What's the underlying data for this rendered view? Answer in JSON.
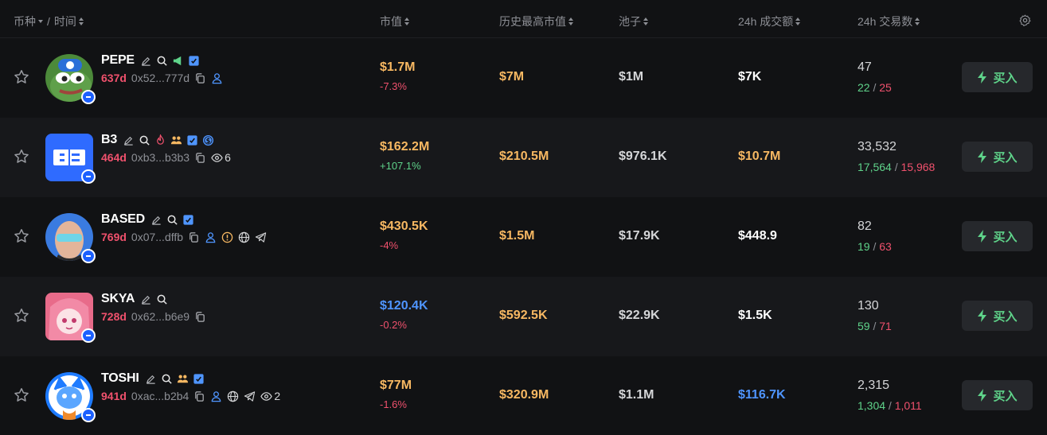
{
  "header": {
    "coin_label": "币种",
    "sep": "/",
    "time_label": "时间",
    "mcap_label": "市值",
    "ath_label": "历史最高市值",
    "pool_label": "池子",
    "vol_label": "24h 成交额",
    "txs_label": "24h 交易数"
  },
  "colors": {
    "bg": "#111214",
    "alt_row": "#17181b",
    "yellow": "#f7b862",
    "blue": "#4f95ff",
    "red": "#f0516d",
    "green": "#5fd38a"
  },
  "buy_label": "买入",
  "rows": [
    {
      "ticker": "PEPE",
      "age": "637d",
      "address": "0x52...777d",
      "badges": [
        "edit-icon",
        "search-icon",
        "megaphone-icon",
        "verified-icon"
      ],
      "line2_icons": [
        "copy-icon",
        "user-icon"
      ],
      "watch_count": "",
      "mcap": "$1.7M",
      "mcap_color": "yellow",
      "change": "-7.3%",
      "change_color": "red",
      "ath": "$7M",
      "pool": "$1M",
      "vol": "$7K",
      "vol_color": "white",
      "txs": "47",
      "buys": "22",
      "sells": "25"
    },
    {
      "ticker": "B3",
      "age": "464d",
      "address": "0xb3...b3b3",
      "badges": [
        "edit-icon",
        "search-icon",
        "fire-icon",
        "group-icon",
        "verified-icon",
        "dollar-icon"
      ],
      "line2_icons": [
        "copy-icon",
        "eye-icon"
      ],
      "watch_count": "6",
      "mcap": "$162.2M",
      "mcap_color": "yellow",
      "change": "+107.1%",
      "change_color": "green",
      "ath": "$210.5M",
      "pool": "$976.1K",
      "vol": "$10.7M",
      "vol_color": "yellow",
      "txs": "33,532",
      "buys": "17,564",
      "sells": "15,968"
    },
    {
      "ticker": "BASED",
      "age": "769d",
      "address": "0x07...dffb",
      "badges": [
        "edit-icon",
        "search-icon",
        "verified-icon"
      ],
      "line2_icons": [
        "copy-icon",
        "user-icon",
        "warning-icon",
        "globe-icon",
        "telegram-icon"
      ],
      "watch_count": "",
      "mcap": "$430.5K",
      "mcap_color": "yellow",
      "change": "-4%",
      "change_color": "red",
      "ath": "$1.5M",
      "pool": "$17.9K",
      "vol": "$448.9",
      "vol_color": "white",
      "txs": "82",
      "buys": "19",
      "sells": "63"
    },
    {
      "ticker": "SKYA",
      "age": "728d",
      "address": "0x62...b6e9",
      "badges": [
        "edit-icon",
        "search-icon"
      ],
      "line2_icons": [
        "copy-icon"
      ],
      "watch_count": "",
      "mcap": "$120.4K",
      "mcap_color": "blue",
      "change": "-0.2%",
      "change_color": "red",
      "ath": "$592.5K",
      "pool": "$22.9K",
      "vol": "$1.5K",
      "vol_color": "white",
      "txs": "130",
      "buys": "59",
      "sells": "71"
    },
    {
      "ticker": "TOSHI",
      "age": "941d",
      "address": "0xac...b2b4",
      "badges": [
        "edit-icon",
        "search-icon",
        "group-icon",
        "verified-icon"
      ],
      "line2_icons": [
        "copy-icon",
        "user-icon",
        "globe-icon",
        "telegram-icon",
        "eye-icon"
      ],
      "watch_count": "2",
      "mcap": "$77M",
      "mcap_color": "yellow",
      "change": "-1.6%",
      "change_color": "red",
      "ath": "$320.9M",
      "pool": "$1.1M",
      "vol": "$116.7K",
      "vol_color": "blue",
      "txs": "2,315",
      "buys": "1,304",
      "sells": "1,011"
    }
  ]
}
